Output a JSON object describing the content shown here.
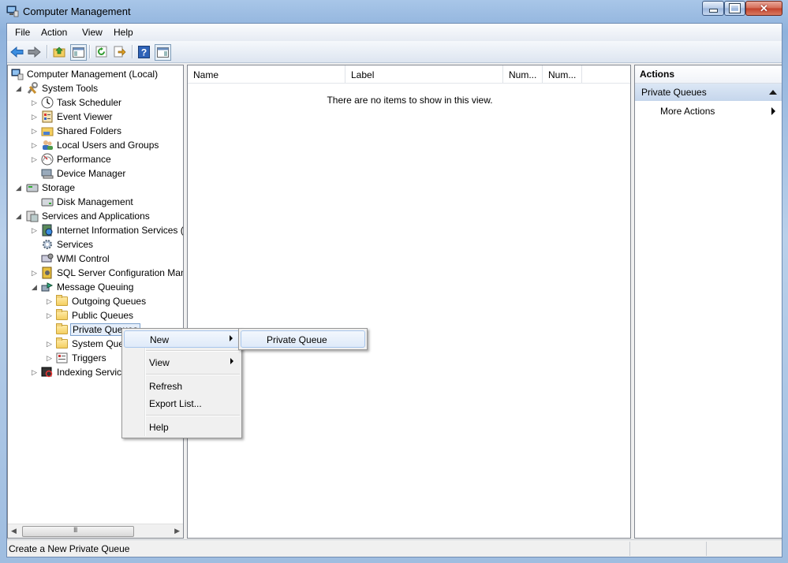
{
  "window": {
    "title": "Computer Management"
  },
  "menu": [
    "File",
    "Action",
    "View",
    "Help"
  ],
  "toolbar_icons": [
    "back-arrow-icon",
    "forward-arrow-icon",
    "up-folder-icon",
    "show-hide-tree-icon",
    "refresh-icon",
    "export-list-icon",
    "help-icon",
    "show-hide-action-pane-icon"
  ],
  "tree": [
    {
      "label": "Computer Management (Local)"
    },
    {
      "label": "System Tools"
    },
    {
      "label": "Task Scheduler"
    },
    {
      "label": "Event Viewer"
    },
    {
      "label": "Shared Folders"
    },
    {
      "label": "Local Users and Groups"
    },
    {
      "label": "Performance"
    },
    {
      "label": "Device Manager"
    },
    {
      "label": "Storage"
    },
    {
      "label": "Disk Management"
    },
    {
      "label": "Services and Applications"
    },
    {
      "label": "Internet Information Services ("
    },
    {
      "label": "Services"
    },
    {
      "label": "WMI Control"
    },
    {
      "label": "SQL Server Configuration Man"
    },
    {
      "label": "Message Queuing"
    },
    {
      "label": "Outgoing Queues"
    },
    {
      "label": "Public Queues"
    },
    {
      "label": "Private Queues"
    },
    {
      "label": "System Que"
    },
    {
      "label": "Triggers"
    },
    {
      "label": "Indexing Service"
    }
  ],
  "list": {
    "columns": [
      "Name",
      "Label",
      "Num...",
      "Num..."
    ],
    "empty_text": "There are no items to show in this view."
  },
  "actions": {
    "header": "Actions",
    "section": "Private Queues",
    "items": [
      "More Actions"
    ]
  },
  "context_menu": {
    "items": [
      "New",
      "View",
      "Refresh",
      "Export List...",
      "Help"
    ],
    "submenu": [
      "Private Queue"
    ]
  },
  "status": "Create a New Private Queue",
  "colors": {
    "accent": "#c5d6ec",
    "selection": "#e5eefa"
  }
}
